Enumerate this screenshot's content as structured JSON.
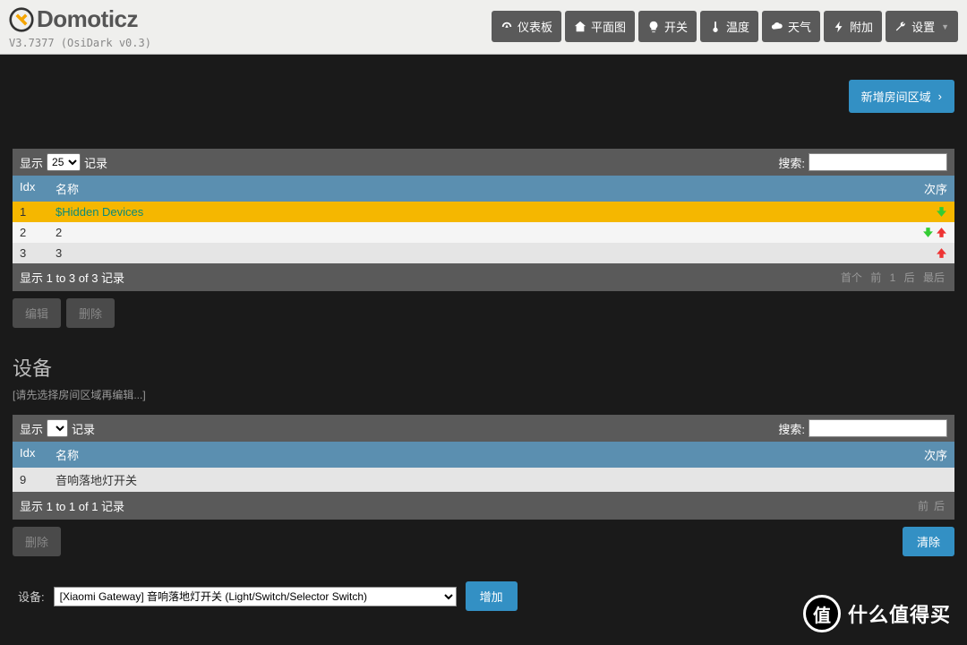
{
  "header": {
    "app_name": "Domoticz",
    "version": "V3.7377 (OsiDark v0.3)"
  },
  "nav": {
    "dashboard": "仪表板",
    "floorplan": "平面图",
    "switches": "开关",
    "temperature": "温度",
    "weather": "天气",
    "utility": "附加",
    "settings": "设置"
  },
  "action": {
    "add_room": "新增房间区域"
  },
  "table1": {
    "show_label": "显示",
    "show_value": "25",
    "records_label": "记录",
    "search_label": "搜索:",
    "head_idx": "Idx",
    "head_name": "名称",
    "head_order": "次序",
    "rows": [
      {
        "idx": "1",
        "name": "$Hidden Devices"
      },
      {
        "idx": "2",
        "name": "2"
      },
      {
        "idx": "3",
        "name": "3"
      }
    ],
    "footer": "显示 1 to 3 of 3 记录",
    "pager_first": "首个",
    "pager_prev": "前",
    "pager_page": "1",
    "pager_next": "后",
    "pager_last": "最后",
    "btn_edit": "编辑",
    "btn_delete": "删除"
  },
  "section": {
    "title": "设备",
    "hint": "[请先选择房间区域再编辑...]"
  },
  "table2": {
    "show_label": "显示",
    "records_label": "记录",
    "search_label": "搜索:",
    "head_idx": "Idx",
    "head_name": "名称",
    "head_order": "次序",
    "rows": [
      {
        "idx": "9",
        "name": "音响落地灯开关"
      }
    ],
    "footer": "显示 1 to 1 of 1 记录",
    "pager_prev": "前",
    "pager_next": "后",
    "btn_delete": "删除",
    "btn_clear": "清除"
  },
  "device_add": {
    "label": "设备:",
    "selected": "[Xiaomi Gateway] 音响落地灯开关 (Light/Switch/Selector Switch)",
    "btn_add": "增加"
  },
  "watermark": {
    "badge": "值",
    "text": "什么值得买"
  }
}
